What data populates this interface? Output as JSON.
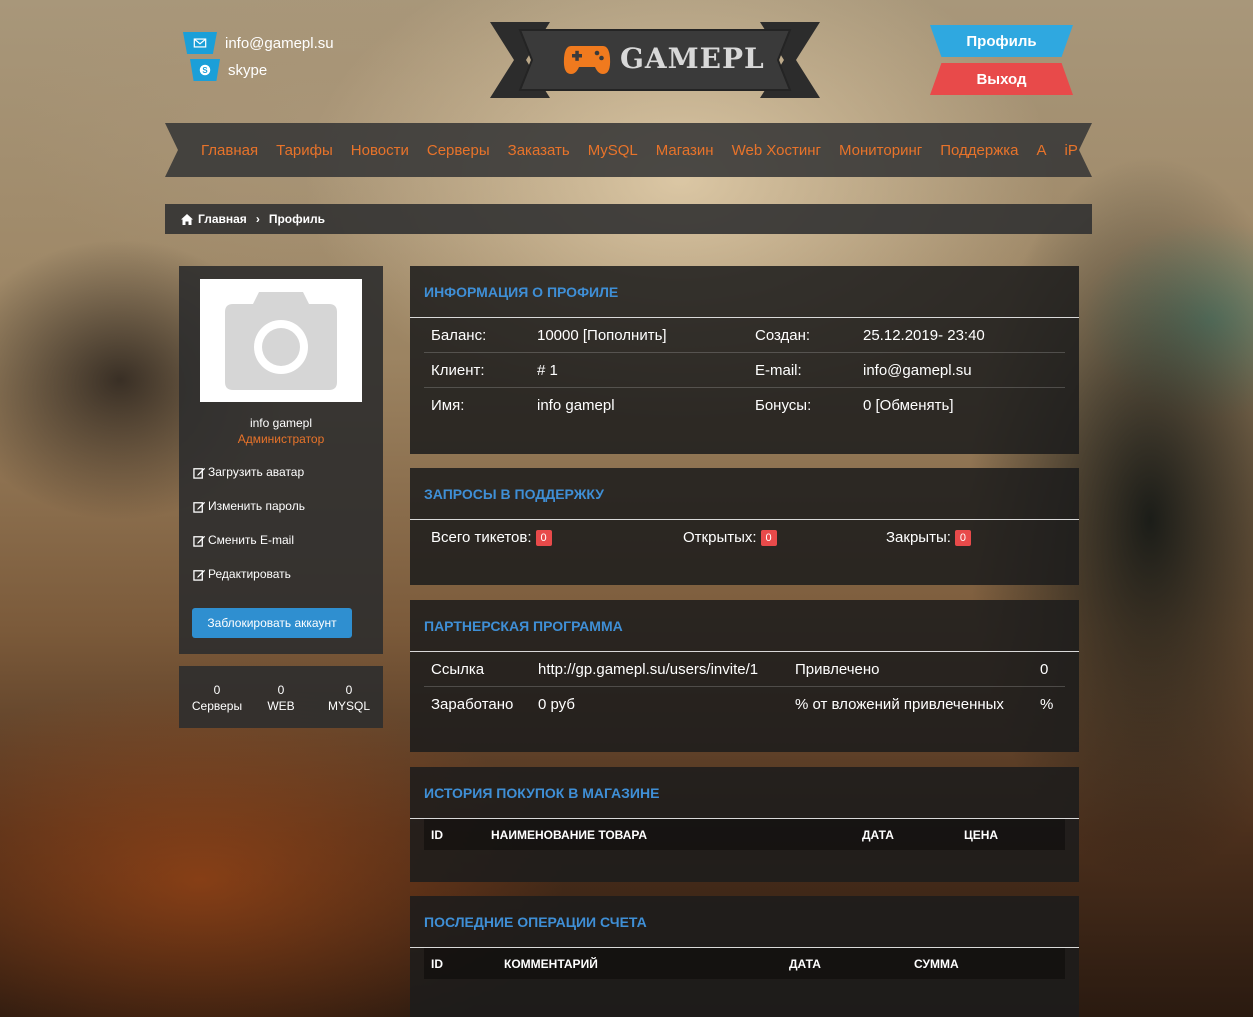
{
  "header": {
    "email": "info@gamepl.su",
    "skype": "skype",
    "logo_text": "GAMEPL",
    "profile_button": "Профиль",
    "logout_button": "Выход"
  },
  "colors": {
    "accent_orange": "#e8732a",
    "accent_blue": "#3f8fd6",
    "badge_red": "#e84a4a"
  },
  "nav": {
    "items": [
      "Главная",
      "Тарифы",
      "Новости",
      "Серверы",
      "Заказать",
      "MySQL",
      "Магазин",
      "Web Хостинг",
      "Мониторинг",
      "Поддержка",
      "A",
      "iP"
    ]
  },
  "breadcrumb": {
    "home": "Главная",
    "separator": "›",
    "current": "Профиль"
  },
  "sidebar": {
    "username": "info gamepl",
    "role": "Администратор",
    "links": [
      "Загрузить аватар",
      "Изменить пароль",
      "Сменить E-mail",
      "Редактировать"
    ],
    "block_button": "Заблокировать аккаунт",
    "stats": [
      {
        "value": "0",
        "label": "Серверы"
      },
      {
        "value": "0",
        "label": "WEB"
      },
      {
        "value": "0",
        "label": "MYSQL"
      }
    ]
  },
  "profile": {
    "title": "ИНФОРМАЦИЯ О ПРОФИЛЕ",
    "balance_label": "Баланс:",
    "balance_value": "10000 [Пополнить]",
    "created_label": "Создан:",
    "created_value": "25.12.2019- 23:40",
    "client_label": "Клиент:",
    "client_value": "# 1",
    "email_label": "E-mail:",
    "email_value": "info@gamepl.su",
    "name_label": "Имя:",
    "name_value": "info gamepl",
    "bonus_label": "Бонусы:",
    "bonus_value": "0 [Обменять]"
  },
  "support": {
    "title": "ЗАПРОСЫ В ПОДДЕРЖКУ",
    "total_label": "Всего тикетов:",
    "total_value": "0",
    "open_label": "Открытых:",
    "open_value": "0",
    "closed_label": "Закрыты:",
    "closed_value": "0"
  },
  "partner": {
    "title": "ПАРТНЕРСКАЯ ПРОГРАММА",
    "link_label": "Ссылка",
    "link_value": "http://gp.gamepl.su/users/invite/1",
    "invited_label": "Привлечено",
    "invited_value": "0",
    "earned_label": "Заработано",
    "earned_value": "0 руб",
    "percent_label": "% от вложений привлеченных",
    "percent_value": "%"
  },
  "shop_history": {
    "title": "ИСТОРИЯ ПОКУПОК В МАГАЗИНЕ",
    "columns": [
      "ID",
      "НАИМЕНОВАНИЕ ТОВАРА",
      "ДАТА",
      "ЦЕНА"
    ]
  },
  "operations": {
    "title": "ПОСЛЕДНИЕ ОПЕРАЦИИ СЧЕТА",
    "columns": [
      "ID",
      "КОММЕНТАРИЙ",
      "ДАТА",
      "СУММА"
    ]
  }
}
